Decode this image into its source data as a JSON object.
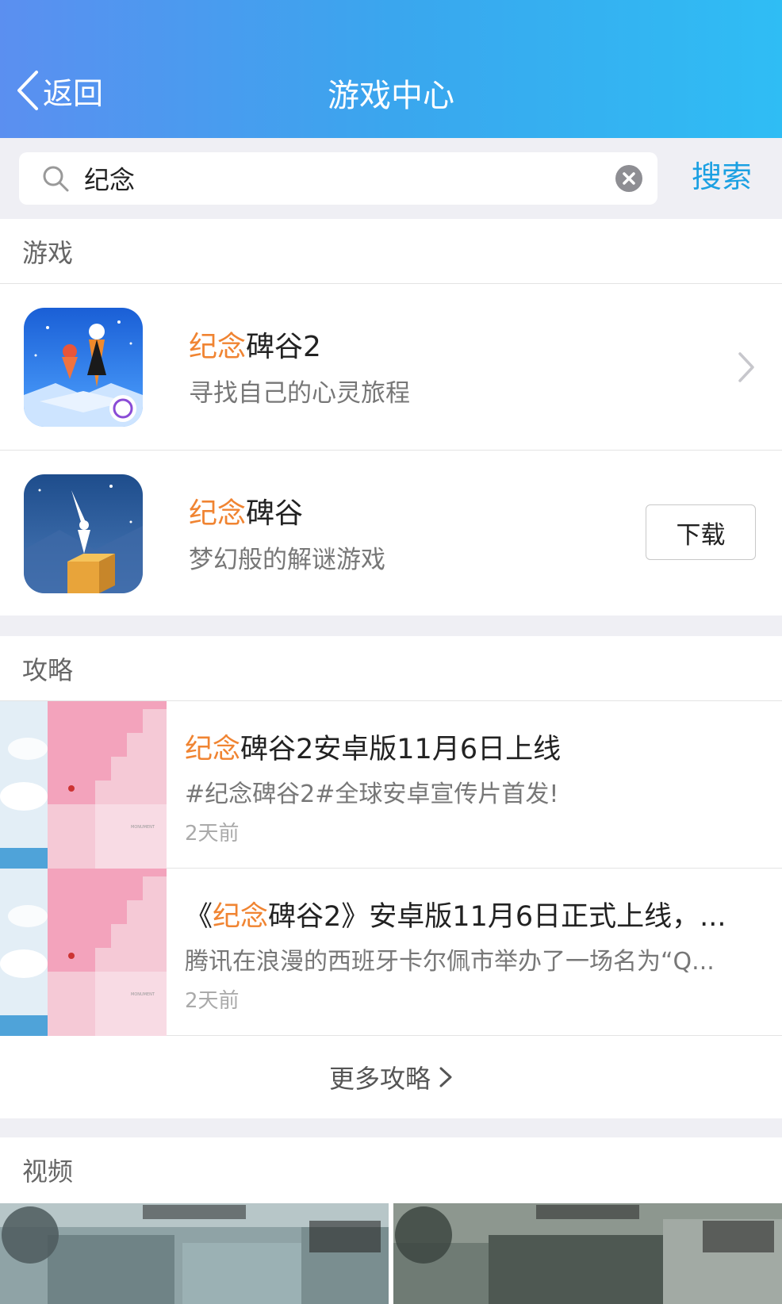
{
  "header": {
    "back_label": "返回",
    "title": "游戏中心"
  },
  "search": {
    "value": "纪念",
    "button_label": "搜索"
  },
  "games_section": {
    "title": "游戏",
    "items": [
      {
        "name_highlight": "纪念",
        "name_rest": "碑谷2",
        "desc": "寻找自己的心灵旅程"
      },
      {
        "name_highlight": "纪念",
        "name_rest": "碑谷",
        "desc": "梦幻般的解谜游戏",
        "button_label": "下载"
      }
    ]
  },
  "guides_section": {
    "title": "攻略",
    "items": [
      {
        "title_prefix": "",
        "title_highlight": "纪念",
        "title_rest": "碑谷2安卓版11月6日上线",
        "desc": "#纪念碑谷2#全球安卓宣传片首发!",
        "time": "2天前"
      },
      {
        "title_prefix": "《",
        "title_highlight": "纪念",
        "title_rest": "碑谷2》安卓版11月6日正式上线，...",
        "desc": "腾讯在浪漫的西班牙卡尔佩市举办了一场名为“Q...",
        "time": "2天前"
      }
    ],
    "more_label": "更多攻略"
  },
  "videos_section": {
    "title": "视频"
  },
  "colors": {
    "highlight": "#f08432",
    "accent": "#1ba0e2"
  }
}
